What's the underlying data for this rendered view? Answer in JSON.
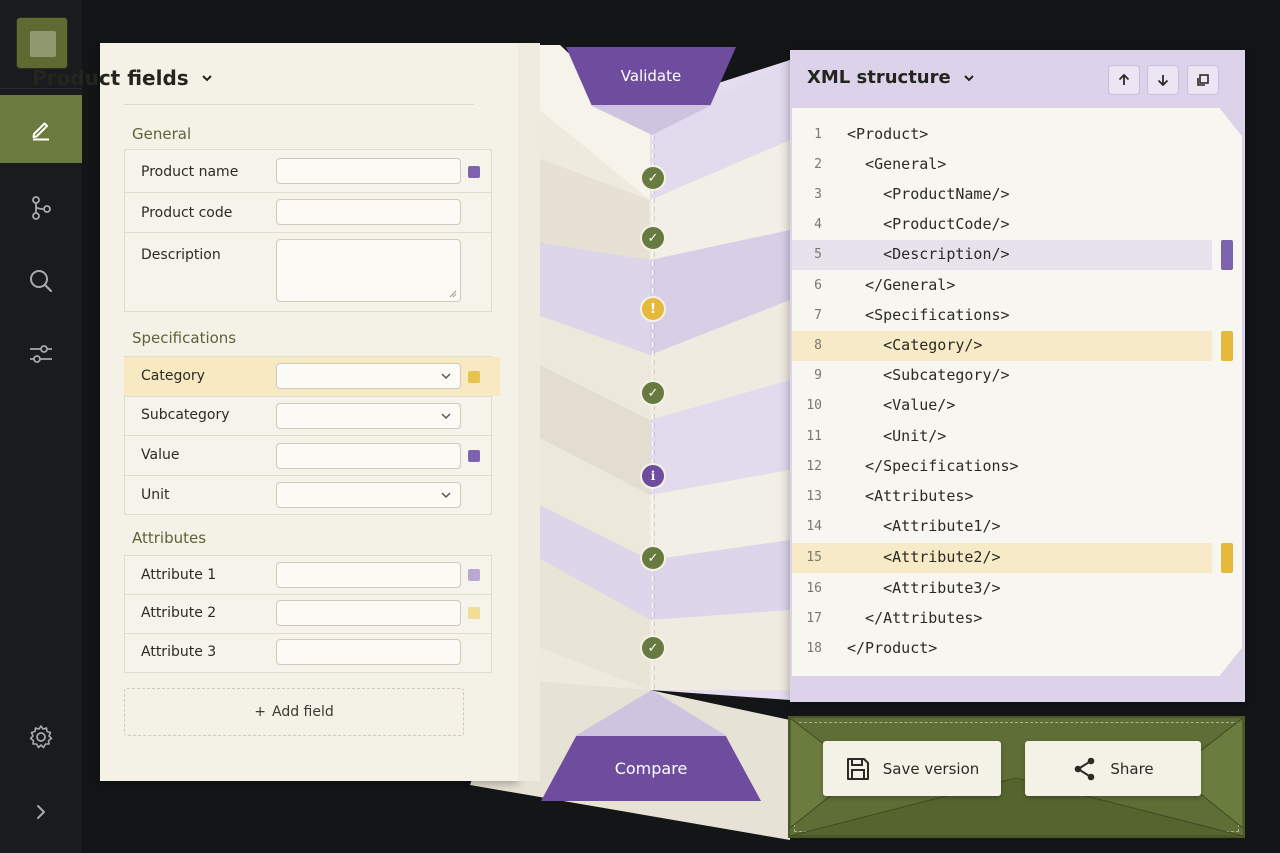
{
  "sidebar": {
    "items": [
      {
        "name": "edit",
        "icon": "pencil-icon",
        "active": true
      },
      {
        "name": "branches",
        "icon": "branch-icon",
        "active": false
      },
      {
        "name": "search",
        "icon": "search-icon",
        "active": false
      },
      {
        "name": "filters",
        "icon": "sliders-icon",
        "active": false
      }
    ],
    "settings_icon": "gear-icon",
    "expand_icon": "chevron-right-icon"
  },
  "fields_panel": {
    "title": "Product fields",
    "sections": {
      "general": {
        "title": "General",
        "rows": [
          {
            "label": "Product name",
            "value": "",
            "status": "purple"
          },
          {
            "label": "Product code",
            "value": ""
          },
          {
            "label": "Description",
            "value": ""
          }
        ]
      },
      "specifications": {
        "title": "Specifications",
        "rows": [
          {
            "label": "Category",
            "value": "",
            "status": "yellow",
            "highlight": true
          },
          {
            "label": "Subcategory",
            "value": ""
          },
          {
            "label": "Value",
            "value": "",
            "status": "purple"
          },
          {
            "label": "Unit",
            "value": ""
          }
        ]
      },
      "attributes": {
        "title": "Attributes",
        "rows": [
          {
            "label": "Attribute 1",
            "value": "",
            "status": "light-purple"
          },
          {
            "label": "Attribute 2",
            "value": "",
            "status": "light-yellow"
          },
          {
            "label": "Attribute 3",
            "value": ""
          }
        ]
      }
    },
    "add_field": {
      "icon": "+",
      "label": "Add field"
    }
  },
  "validation": {
    "validate_label": "Validate",
    "compare_label": "Compare",
    "checkpoints": [
      "ok",
      "ok",
      "warning",
      "ok",
      "info",
      "ok",
      "ok"
    ]
  },
  "xml_panel": {
    "title": "XML structure",
    "tools": [
      "arrow-up-icon",
      "arrow-down-icon",
      "copy-icon"
    ],
    "lines": [
      {
        "n": "1",
        "text": "<Product>"
      },
      {
        "n": "2",
        "text": "  <General>"
      },
      {
        "n": "3",
        "text": "    <ProductName/>"
      },
      {
        "n": "4",
        "text": "    <ProductCode/>"
      },
      {
        "n": "5",
        "text": "    <Description/>",
        "highlight": "purple"
      },
      {
        "n": "6",
        "text": "  </General>"
      },
      {
        "n": "7",
        "text": "  <Specifications>"
      },
      {
        "n": "8",
        "text": "    <Category/>",
        "highlight": "yellow"
      },
      {
        "n": "9",
        "text": "    <Subcategory/>"
      },
      {
        "n": "10",
        "text": "    <Value/>"
      },
      {
        "n": "11",
        "text": "    <Unit/>"
      },
      {
        "n": "12",
        "text": "  </Specifications>"
      },
      {
        "n": "13",
        "text": "  <Attributes>"
      },
      {
        "n": "14",
        "text": "    <Attribute1/>"
      },
      {
        "n": "15",
        "text": "    <Attribute2/>",
        "highlight": "yellow"
      },
      {
        "n": "16",
        "text": "    <Attribute3/>"
      },
      {
        "n": "17",
        "text": "  </Attributes>"
      },
      {
        "n": "18",
        "text": "</Product>"
      }
    ]
  },
  "actions": {
    "save_version_label": "Save version",
    "share_label": "Share"
  },
  "colors": {
    "accent_purple": "#6e4d9e",
    "accent_olive": "#677a3f",
    "warning_yellow": "#e4b93c",
    "paper": "#f4f1e7"
  }
}
